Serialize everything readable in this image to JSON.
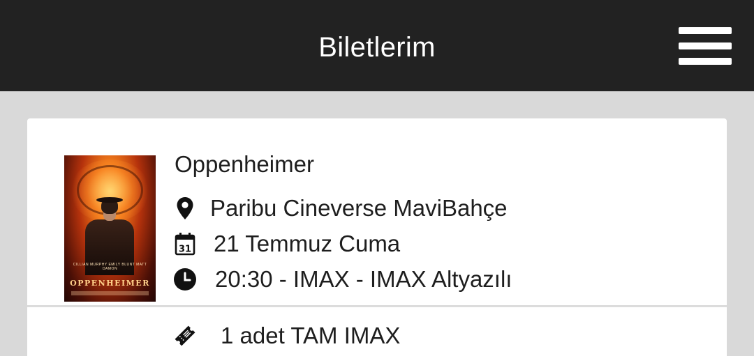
{
  "header": {
    "title": "Biletlerim",
    "menu_icon": "hamburger-menu-icon"
  },
  "ticket": {
    "poster": {
      "credit_line": "CILLIAN MURPHY   EMILY BLUNT   MATT DAMON",
      "title_text": "OPPENHEIMER"
    },
    "movie_title": "Oppenheimer",
    "cinema": "Paribu Cineverse MaviBahçe",
    "date": "21 Temmuz Cuma",
    "calendar_day": "31",
    "showtime": "20:30 - IMAX - IMAX Altyazılı",
    "seats": "1 adet TAM IMAX"
  },
  "colors": {
    "header_bg": "#222222",
    "page_bg": "#d9d9d9",
    "card_bg": "#ffffff",
    "text": "#1e1e1e"
  }
}
